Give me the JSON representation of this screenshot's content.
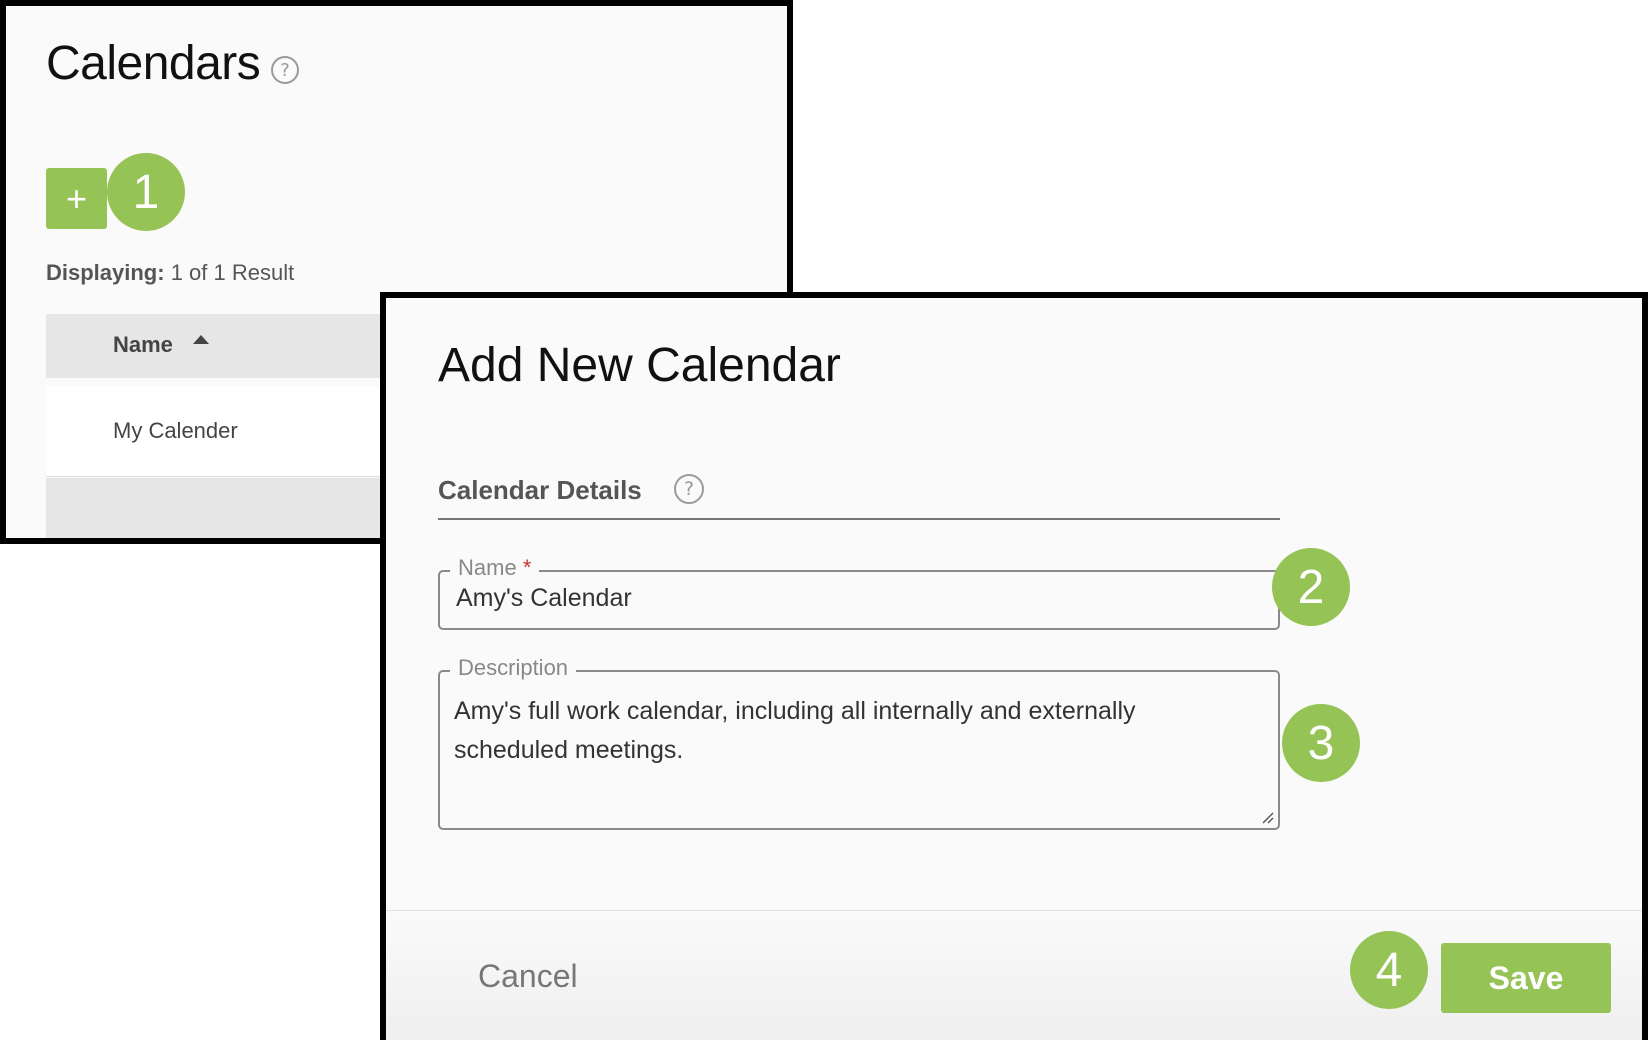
{
  "calendars_page": {
    "title": "Calendars",
    "help_icon": "question-circle-icon",
    "add_icon": "+",
    "displaying_label": "Displaying:",
    "displaying_value": "1 of 1 Result",
    "table": {
      "columns": [
        "Name"
      ],
      "sort_icon": "sort-ascending-icon",
      "rows": [
        {
          "name": "My Calender"
        }
      ]
    }
  },
  "modal": {
    "title": "Add New Calendar",
    "section_title": "Calendar Details",
    "help_icon": "question-circle-icon",
    "name_field": {
      "label": "Name",
      "required_marker": "*",
      "value": "Amy's Calendar"
    },
    "description_field": {
      "label": "Description",
      "value": "Amy's full work calendar, including all internally and externally scheduled meetings."
    },
    "cancel_label": "Cancel",
    "save_label": "Save"
  },
  "step_badges": [
    "1",
    "2",
    "3",
    "4"
  ],
  "colors": {
    "accent_green": "#96c356",
    "border_black": "#000000",
    "required_red": "#c0392b"
  }
}
